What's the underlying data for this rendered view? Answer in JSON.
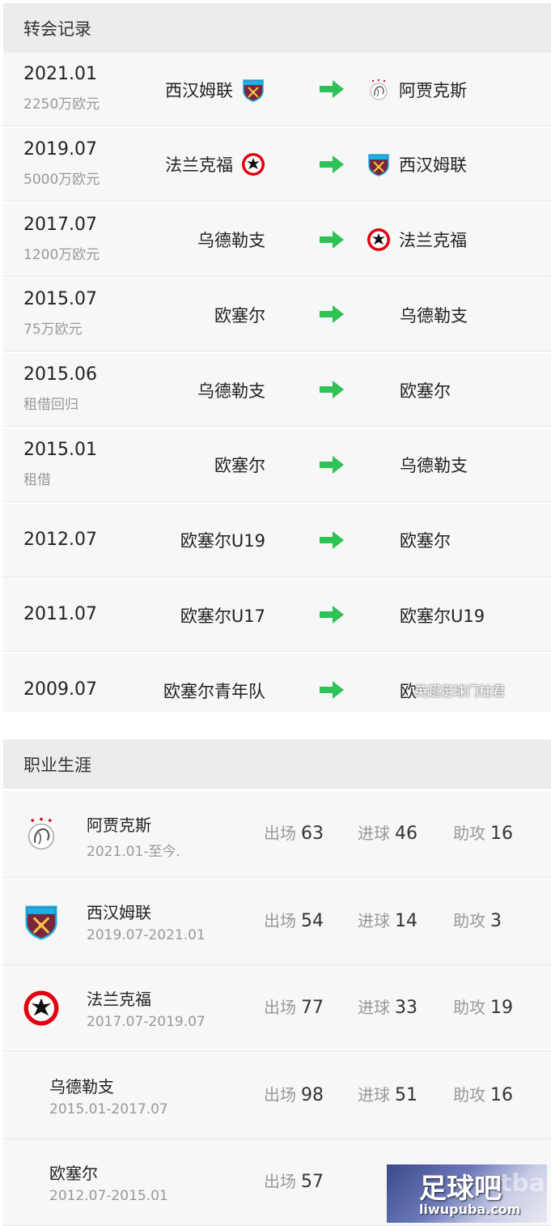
{
  "transfer_section": {
    "title": "转会记录"
  },
  "transfers": [
    {
      "date": "2021.01",
      "fee": "2250万欧元",
      "from": "西汉姆联",
      "from_icon": "westham-crest-icon",
      "to": "阿贾克斯",
      "to_icon": "ajax-crest-icon"
    },
    {
      "date": "2019.07",
      "fee": "5000万欧元",
      "from": "法兰克福",
      "from_icon": "frankfurt-crest-icon",
      "to": "西汉姆联",
      "to_icon": "westham-crest-icon"
    },
    {
      "date": "2017.07",
      "fee": "1200万欧元",
      "from": "乌德勒支",
      "from_icon": "",
      "to": "法兰克福",
      "to_icon": "frankfurt-crest-icon"
    },
    {
      "date": "2015.07",
      "fee": "75万欧元",
      "from": "欧塞尔",
      "from_icon": "",
      "to": "乌德勒支",
      "to_icon": ""
    },
    {
      "date": "2015.06",
      "fee": "租借回归",
      "from": "乌德勒支",
      "from_icon": "",
      "to": "欧塞尔",
      "to_icon": ""
    },
    {
      "date": "2015.01",
      "fee": "租借",
      "from": "欧塞尔",
      "from_icon": "",
      "to": "乌德勒支",
      "to_icon": ""
    },
    {
      "date": "2012.07",
      "fee": "",
      "from": "欧塞尔U19",
      "from_icon": "",
      "to": "欧塞尔",
      "to_icon": ""
    },
    {
      "date": "2011.07",
      "fee": "",
      "from": "欧塞尔U17",
      "from_icon": "",
      "to": "欧塞尔U19",
      "to_icon": ""
    },
    {
      "date": "2009.07",
      "fee": "",
      "from": "欧塞尔青年队",
      "from_icon": "",
      "to": "欧",
      "to_icon": ""
    }
  ],
  "watermark": {
    "text": "英超足球门柱君"
  },
  "career_section": {
    "title": "职业生涯"
  },
  "stat_labels": {
    "apps": "出场",
    "goals": "进球",
    "assists": "助攻"
  },
  "career": [
    {
      "club": "阿贾克斯",
      "period": "2021.01-至今.",
      "apps": "63",
      "goals": "46",
      "assists": "16",
      "icon": "ajax-crest-icon"
    },
    {
      "club": "西汉姆联",
      "period": "2019.07-2021.01",
      "apps": "54",
      "goals": "14",
      "assists": "3",
      "icon": "westham-crest-icon"
    },
    {
      "club": "法兰克福",
      "period": "2017.07-2019.07",
      "apps": "77",
      "goals": "33",
      "assists": "19",
      "icon": "frankfurt-crest-icon"
    },
    {
      "club": "乌德勒支",
      "period": "2015.01-2017.07",
      "apps": "98",
      "goals": "51",
      "assists": "16",
      "icon": ""
    },
    {
      "club": "欧塞尔",
      "period": "2012.07-2015.01",
      "apps": "57",
      "goals": "",
      "assists": "",
      "icon": ""
    }
  ],
  "site_logo": {
    "main": "足球吧",
    "url": "liwupuba.com",
    "bg_text": "otba"
  },
  "colors": {
    "arrow": "#2fc256",
    "westham_claret": "#7a263a",
    "westham_blue": "#1bb1e7",
    "frankfurt_red": "#e1000f"
  }
}
